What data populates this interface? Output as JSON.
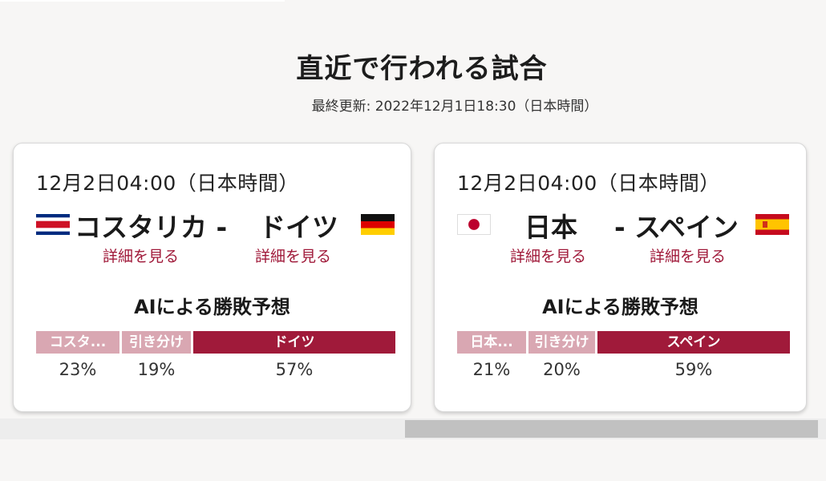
{
  "section": {
    "title": "直近で行われる試合",
    "updated": "最終更新: 2022年12月1日18:30（日本時間）"
  },
  "matches": [
    {
      "datetime": "12月2日04:00（日本時間）",
      "home": {
        "name": "コスタリカ -",
        "flag": "costa-rica-flag-icon",
        "detail": "詳細を見る"
      },
      "away": {
        "name": "ドイツ",
        "flag": "germany-flag-icon",
        "detail": "詳細を見る"
      },
      "prediction": {
        "title": "AIによる勝敗予想",
        "labels": [
          "コスタ...",
          "引き分け",
          "ドイツ"
        ],
        "percents": [
          "23%",
          "19%",
          "57%"
        ]
      }
    },
    {
      "datetime": "12月2日04:00（日本時間）",
      "home": {
        "name": "日本",
        "flag": "japan-flag-icon",
        "detail": "詳細を見る"
      },
      "away": {
        "name": "- スペイン",
        "flag": "spain-flag-icon",
        "detail": "詳細を見る"
      },
      "prediction": {
        "title": "AIによる勝敗予想",
        "labels": [
          "日本...",
          "引き分け",
          "スペイン"
        ],
        "percents": [
          "21%",
          "20%",
          "59%"
        ]
      }
    }
  ],
  "colors": {
    "accent": "#a01a3a",
    "accent_light": "#d9a7b2"
  }
}
